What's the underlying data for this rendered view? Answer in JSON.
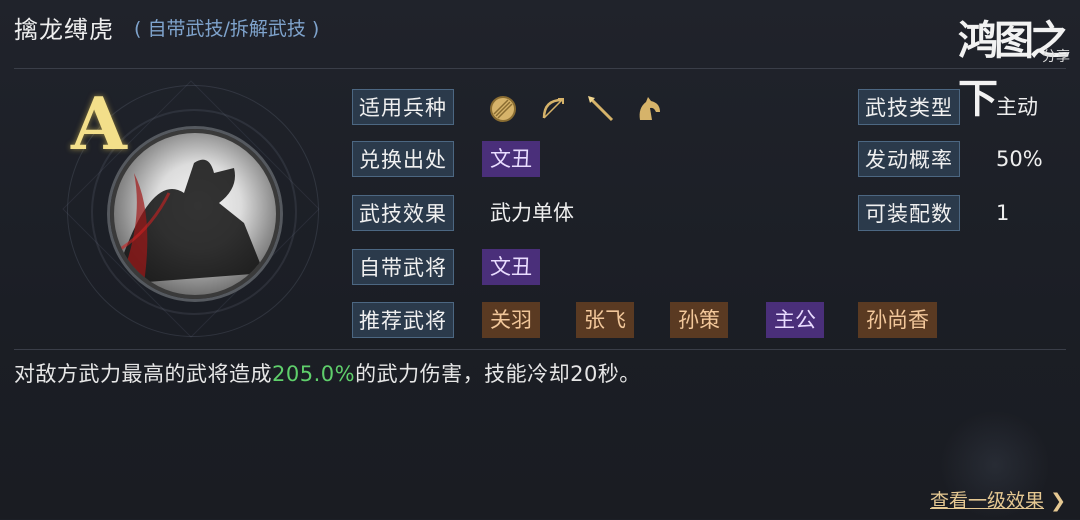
{
  "header": {
    "title": "擒龙缚虎",
    "subtitle": "( 自带武技/拆解武技 )"
  },
  "logo": {
    "main": "鸿图之下",
    "sub": "分享"
  },
  "skill": {
    "grade": "A",
    "labels": {
      "troop": "适用兵种",
      "source": "兑换出处",
      "effect": "武技效果",
      "own_general": "自带武将",
      "recommend": "推荐武将",
      "type": "武技类型",
      "trigger": "发动概率",
      "equip": "可装配数"
    },
    "values": {
      "source": "文丑",
      "effect": "武力单体",
      "own_general": "文丑",
      "type": "主动",
      "trigger": "50%",
      "equip": "1"
    },
    "troop_icons": [
      "shield-icon",
      "bow-icon",
      "spear-icon",
      "horse-icon"
    ],
    "recommend": [
      "关羽",
      "张飞",
      "孙策",
      "主公",
      "孙尚香"
    ]
  },
  "description": {
    "before": "对敌方武力最高的武将造成",
    "highlight": "205.0%",
    "after": "的武力伤害，技能冷却20秒。"
  },
  "footer": {
    "link": "查看一级效果",
    "arrow": "❯"
  },
  "colors": {
    "highlight": "#5fcf6b",
    "label_bg": "#2b3a4b",
    "tag_purple": "#4a2f7a",
    "tag_brown": "#5a3a22",
    "link": "#e5c892"
  }
}
